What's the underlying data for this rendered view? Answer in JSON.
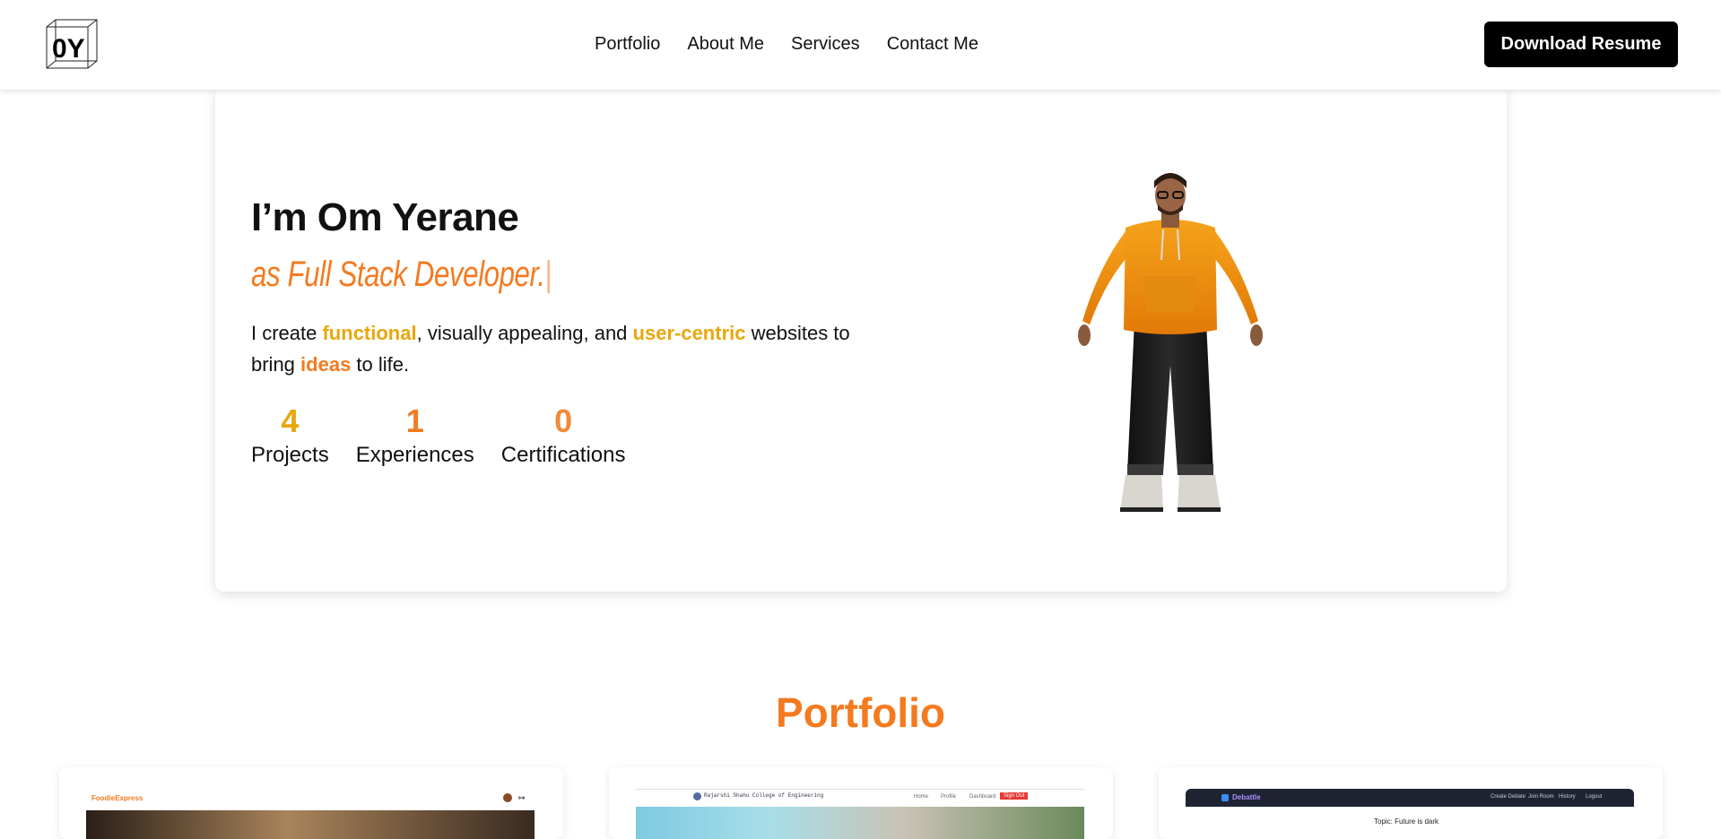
{
  "header": {
    "logo_text": "0Y",
    "nav": [
      "Portfolio",
      "About Me",
      "Services",
      "Contact Me"
    ],
    "resume_button": "Download Resume"
  },
  "hero": {
    "title": "I’m Om Yerane",
    "role": "as Full Stack Developer.",
    "role_caret": "|",
    "desc": {
      "p1": "I create ",
      "h1": "functional",
      "p2": ", visually appealing, and ",
      "h2": "user-centric",
      "p3": " websites to bring ",
      "h3": "ideas",
      "p4": " to life."
    },
    "stats": [
      {
        "value": "4",
        "label": "Projects",
        "color": "#e8a70d"
      },
      {
        "value": "1",
        "label": "Experiences",
        "color": "#f47a1f"
      },
      {
        "value": "0",
        "label": "Certifications",
        "color": "#f28a3a"
      }
    ]
  },
  "portfolio": {
    "title": "Portfolio",
    "cards": [
      {
        "brand": "FoodieExpress"
      },
      {
        "brand": "Rajarshi Shahu College of Engineering",
        "nav": [
          "Home",
          "Profile",
          "Dashboard"
        ],
        "action": "Sign Out"
      },
      {
        "brand": "Debattle",
        "nav": [
          "Create Debate",
          "Join Room",
          "History",
          "Logout"
        ],
        "topic": "Topic: Future is dark"
      }
    ]
  },
  "colors": {
    "accent_orange": "#f47a1f",
    "accent_yellow": "#e8a70d",
    "button_bg": "#000000"
  }
}
